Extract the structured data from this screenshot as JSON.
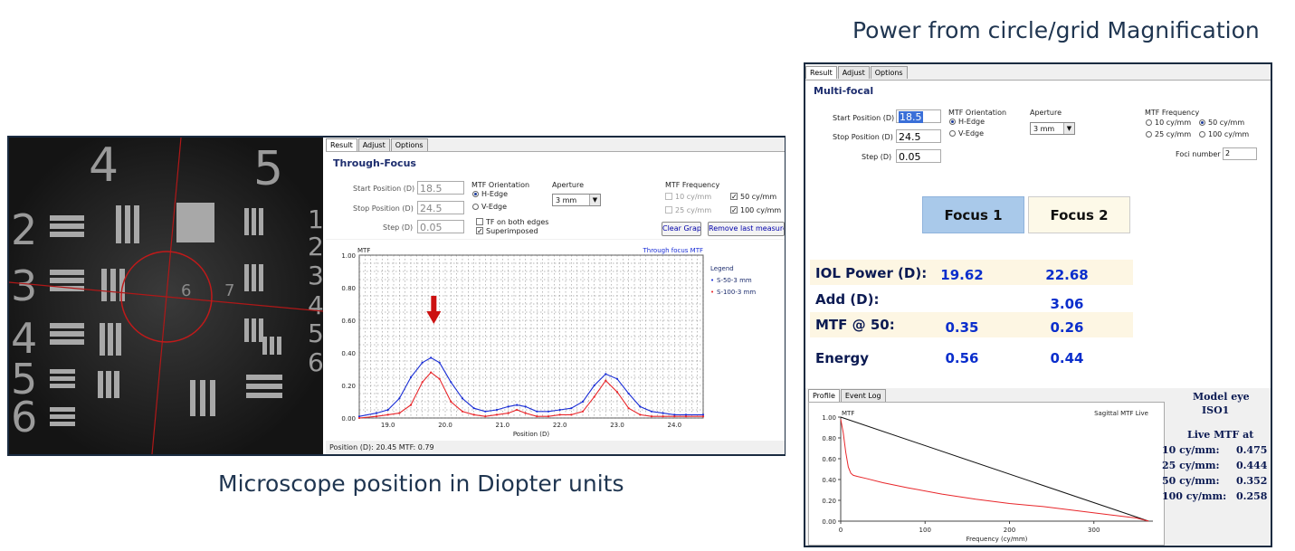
{
  "captions": {
    "right_title": "Power from circle/grid Magnification",
    "left_caption": "Microscope position in Diopter units"
  },
  "microscope_image": {
    "chart_numbers": [
      "4",
      "5",
      "2",
      "3",
      "4",
      "5",
      "6",
      "1",
      "2",
      "3",
      "4",
      "5",
      "6",
      "7",
      "6"
    ]
  },
  "through_focus_panel": {
    "tabs": [
      "Result",
      "Adjust",
      "Options"
    ],
    "title": "Through-Focus",
    "start_label": "Start Position (D)",
    "start_value": "18.5",
    "stop_label": "Stop Position (D)",
    "stop_value": "24.5",
    "step_label": "Step (D)",
    "step_value": "0.05",
    "orientation_label": "MTF Orientation",
    "h_edge": "H-Edge",
    "v_edge": "V-Edge",
    "tf_both": "TF on both edges",
    "superimposed": "Superimposed",
    "aperture_label": "Aperture",
    "aperture_value": "3 mm",
    "freq_label": "MTF Frequency",
    "freq_10": "10 cy/mm",
    "freq_25": "25 cy/mm",
    "freq_50": "50 cy/mm",
    "freq_100": "100 cy/mm",
    "clear_graph": "Clear Graph",
    "remove_last": "Remove last measurement",
    "status": "Position (D): 20.45 MTF: 0.79"
  },
  "multifocal_panel": {
    "tabs": [
      "Result",
      "Adjust",
      "Options"
    ],
    "title": "Multi-focal",
    "start_label": "Start Position (D)",
    "start_value": "18.5",
    "stop_label": "Stop Position (D)",
    "stop_value": "24.5",
    "step_label": "Step (D)",
    "step_value": "0.05",
    "orientation_label": "MTF Orientation",
    "h_edge": "H-Edge",
    "v_edge": "V-Edge",
    "aperture_label": "Aperture",
    "aperture_value": "3 mm",
    "freq_label": "MTF Frequency",
    "freq_10": "10 cy/mm",
    "freq_25": "25 cy/mm",
    "freq_50": "50 cy/mm",
    "freq_100": "100 cy/mm",
    "foci_label": "Foci number",
    "foci_value": "2",
    "focus1": "Focus 1",
    "focus2": "Focus 2",
    "rows": [
      {
        "label": "IOL Power (D):",
        "v1": "19.62",
        "v2": "22.68"
      },
      {
        "label": "Add (D):",
        "v1": "",
        "v2": "3.06"
      },
      {
        "label": "MTF @ 50:",
        "v1": "0.35",
        "v2": "0.26"
      },
      {
        "label": "Energy",
        "v1": "0.56",
        "v2": "0.44"
      }
    ],
    "bottom_tabs": [
      "Profile",
      "Event Log"
    ],
    "model_eye_label": "Model eye",
    "model_eye_value": "ISO1",
    "live_mtf_label": "Live MTF at",
    "live": [
      {
        "freq": "10 cy/mm:",
        "value": "0.475"
      },
      {
        "freq": "25 cy/mm:",
        "value": "0.444"
      },
      {
        "freq": "50 cy/mm:",
        "value": "0.352"
      },
      {
        "freq": "100 cy/mm:",
        "value": "0.258"
      }
    ]
  },
  "chart_data": [
    {
      "type": "line",
      "title": "Through focus MTF",
      "ylabel": "MTF",
      "xlabel": "Position (D)",
      "xlim": [
        18.5,
        24.5
      ],
      "ylim": [
        0,
        1
      ],
      "xticks": [
        "19.0",
        "20.0",
        "21.0",
        "22.0",
        "23.0",
        "24.0"
      ],
      "yticks": [
        "0.00",
        "0.20",
        "0.40",
        "0.60",
        "0.80",
        "1.00"
      ],
      "grid": true,
      "legend_title": "Legend",
      "legend_position": "right",
      "series": [
        {
          "name": "S-50-3 mm",
          "color": "#1a2ed6",
          "x": [
            18.5,
            18.8,
            19.0,
            19.2,
            19.4,
            19.6,
            19.75,
            19.9,
            20.1,
            20.3,
            20.5,
            20.7,
            20.9,
            21.1,
            21.25,
            21.4,
            21.6,
            21.8,
            22.0,
            22.2,
            22.4,
            22.6,
            22.8,
            23.0,
            23.2,
            23.4,
            23.6,
            23.8,
            24.0,
            24.2,
            24.5
          ],
          "y": [
            0.01,
            0.03,
            0.05,
            0.12,
            0.25,
            0.34,
            0.37,
            0.34,
            0.22,
            0.12,
            0.06,
            0.04,
            0.05,
            0.07,
            0.08,
            0.07,
            0.04,
            0.04,
            0.05,
            0.06,
            0.1,
            0.2,
            0.27,
            0.24,
            0.15,
            0.07,
            0.04,
            0.03,
            0.02,
            0.02,
            0.02
          ]
        },
        {
          "name": "S-100-3 mm",
          "color": "#e8262a",
          "x": [
            18.5,
            18.8,
            19.0,
            19.2,
            19.4,
            19.6,
            19.75,
            19.9,
            20.1,
            20.3,
            20.5,
            20.7,
            20.9,
            21.1,
            21.25,
            21.4,
            21.6,
            21.8,
            22.0,
            22.2,
            22.4,
            22.6,
            22.8,
            23.0,
            23.2,
            23.4,
            23.6,
            23.8,
            24.0,
            24.2,
            24.5
          ],
          "y": [
            0.0,
            0.01,
            0.02,
            0.03,
            0.08,
            0.22,
            0.28,
            0.24,
            0.1,
            0.04,
            0.02,
            0.01,
            0.02,
            0.03,
            0.05,
            0.03,
            0.01,
            0.01,
            0.02,
            0.02,
            0.04,
            0.13,
            0.23,
            0.16,
            0.06,
            0.02,
            0.01,
            0.01,
            0.01,
            0.01,
            0.01
          ]
        }
      ],
      "annotations": [
        {
          "type": "arrow",
          "x": 19.8,
          "color": "#cc1111"
        }
      ]
    },
    {
      "type": "line",
      "title": "Sagittal MTF Live",
      "ylabel": "MTF",
      "xlabel": "Frequency (cy/mm)",
      "xlim": [
        0,
        370
      ],
      "ylim": [
        0,
        1
      ],
      "xticks": [
        "0",
        "100",
        "200",
        "300"
      ],
      "yticks": [
        "0.00",
        "0.20",
        "0.40",
        "0.60",
        "0.80",
        "1.00"
      ],
      "grid": false,
      "series": [
        {
          "name": "",
          "color": "#111111",
          "x": [
            0,
            365
          ],
          "y": [
            1.0,
            0.0
          ]
        },
        {
          "name": "",
          "color": "#e8262a",
          "x": [
            0,
            3,
            6,
            9,
            12,
            15,
            20,
            30,
            50,
            80,
            120,
            160,
            200,
            240,
            280,
            320,
            350,
            365
          ],
          "y": [
            0.98,
            0.85,
            0.66,
            0.52,
            0.46,
            0.44,
            0.43,
            0.41,
            0.37,
            0.32,
            0.26,
            0.21,
            0.17,
            0.14,
            0.1,
            0.06,
            0.03,
            0.0
          ]
        }
      ]
    }
  ]
}
